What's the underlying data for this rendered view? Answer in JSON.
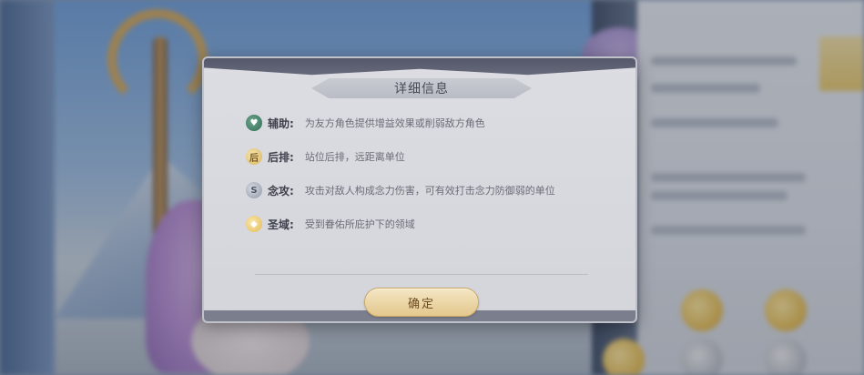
{
  "dialog": {
    "title": "详细信息",
    "rows": [
      {
        "icon": "support-icon",
        "label": "辅助:",
        "desc": "为友方角色提供增益效果或削弱敌方角色"
      },
      {
        "icon": "back-row-icon",
        "label": "后排:",
        "desc": "站位后排，远距离单位"
      },
      {
        "icon": "psychic-attack-icon",
        "label": "念攻:",
        "desc": "攻击对敌人构成念力伤害，可有效打击念力防御弱的单位"
      },
      {
        "icon": "sanctuary-icon",
        "label": "圣域:",
        "desc": "受到眷佑所庇护下的领域"
      }
    ],
    "confirm_label": "确定",
    "icon_glyphs": {
      "support": "♥",
      "back": "后",
      "psychic": "S",
      "sanctuary": "◆"
    }
  },
  "colors": {
    "dialog_bg": "#d6d8de",
    "button_gold": "#e3c88d",
    "title_text": "#4a4d58"
  }
}
